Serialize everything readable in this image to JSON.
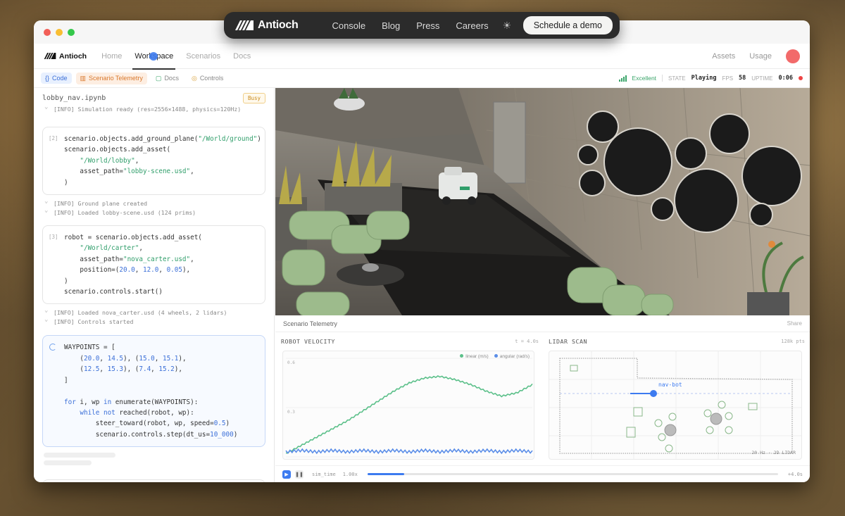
{
  "topnav": {
    "brand": "Antioch",
    "links": [
      "Console",
      "Blog",
      "Press",
      "Careers"
    ],
    "demo_label": "Schedule a demo"
  },
  "appnav": {
    "brand": "Antioch",
    "tabs": [
      "Home",
      "Workspace",
      "Scenarios",
      "Docs"
    ],
    "active_tab": "Workspace",
    "right": [
      "Assets",
      "Usage"
    ]
  },
  "toolbar": {
    "views": [
      "Code",
      "Scenario Telemetry",
      "Docs",
      "Controls"
    ],
    "connection": "Excellent",
    "state_label": "STATE",
    "state_value": "Playing",
    "fps_label": "FPS",
    "fps_value": "58",
    "uptime_label": "UPTIME",
    "uptime_value": "0:06",
    "colors": {
      "accent": "#3d7bf0",
      "telemetry": "#d9782c",
      "good": "#3aa56a",
      "live": "#e44444"
    }
  },
  "notebook": {
    "filename": "lobby_nav.ipynb",
    "status": "Busy",
    "log0": "[INFO] Simulation ready (res=2556×1488, physics=120Hz)",
    "cell2_num": "[2]",
    "log2a": "[INFO] Ground plane created",
    "log2b": "[INFO] Loaded lobby-scene.usd (124 prims)",
    "cell3_num": "[3]",
    "log3a": "[INFO] Loaded nova_carter.usd (4 wheels, 2 lidars)",
    "log3b": "[INFO] Controls started"
  },
  "telemetry": {
    "header": "Scenario Telemetry",
    "share": "Share",
    "velocity": {
      "title": "ROBOT VELOCITY",
      "time": "t = 4.0s",
      "legend_linear": "linear (m/s)",
      "legend_angular": "angular (rad/s)"
    },
    "lidar": {
      "title": "LIDAR SCAN",
      "points": "128k pts",
      "robot_label": "nav-bot",
      "footer": "20 Hz · 2D LIDAR"
    },
    "playbar": {
      "label": "sim_time",
      "speed": "1.00x",
      "progress": 0.09,
      "end": "+4.0s"
    }
  },
  "chart_data": {
    "type": "line",
    "title": "ROBOT VELOCITY",
    "xlabel": "",
    "ylabel": "",
    "ylim": [
      0,
      0.6
    ],
    "yticks": [
      "0.6",
      "0.3",
      "0"
    ],
    "x": [
      0,
      0.25,
      0.5,
      0.75,
      1.0,
      1.25,
      1.5,
      1.75,
      2.0,
      2.25,
      2.5,
      2.75,
      3.0,
      3.25,
      3.5,
      3.75,
      4.0
    ],
    "series": [
      {
        "name": "linear (m/s)",
        "color": "#5cc08a",
        "values": [
          0.02,
          0.07,
          0.12,
          0.17,
          0.22,
          0.28,
          0.34,
          0.4,
          0.45,
          0.48,
          0.49,
          0.47,
          0.44,
          0.4,
          0.37,
          0.39,
          0.44
        ]
      },
      {
        "name": "angular (rad/s)",
        "color": "#5b8ee8",
        "values": [
          0.03,
          0.04,
          0.03,
          0.04,
          0.03,
          0.04,
          0.03,
          0.04,
          0.03,
          0.04,
          0.03,
          0.04,
          0.03,
          0.04,
          0.03,
          0.04,
          0.03
        ]
      }
    ]
  }
}
